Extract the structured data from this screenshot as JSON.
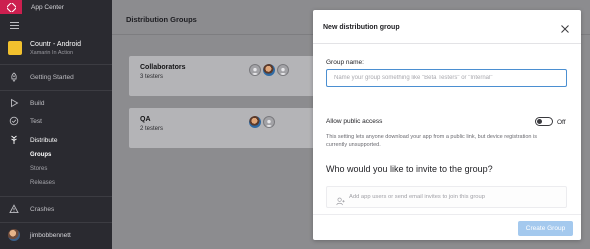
{
  "sidebar": {
    "app_center_label": "App Center",
    "app": {
      "name": "Countr - Android",
      "subtitle": "Xamarin In Action",
      "tile_color": "#f2c12e"
    },
    "items": [
      {
        "label": "Getting Started",
        "icon": "rocket-icon"
      },
      {
        "label": "Build",
        "icon": "play-icon"
      },
      {
        "label": "Test",
        "icon": "check-circle-icon"
      },
      {
        "label": "Distribute",
        "icon": "distribute-icon"
      },
      {
        "label": "Crashes",
        "icon": "warning-icon"
      }
    ],
    "distribute_sub": [
      {
        "label": "Groups"
      },
      {
        "label": "Stores"
      },
      {
        "label": "Releases"
      }
    ],
    "user": {
      "name": "jimbobbennett"
    },
    "brand_color": "#cc1f4f"
  },
  "main": {
    "title": "Distribution Groups",
    "groups": [
      {
        "name": "Collaborators",
        "count": "3 testers"
      },
      {
        "name": "QA",
        "count": "2 testers"
      }
    ]
  },
  "modal": {
    "title": "New distribution group",
    "group_name_label": "Group name:",
    "group_name_placeholder": "Name your group something like \"Beta Testers\" or \"Internal\"",
    "group_name_value": "",
    "public_access_label": "Allow public access",
    "public_access_state": "Off",
    "public_access_desc": "This setting lets anyone download your app from a public link, but device registration is currently unsupported.",
    "invite_heading": "Who would you like to invite to the group?",
    "invite_placeholder": "Add app users or send email invites to join this group",
    "create_button": "Create Group",
    "accent_color": "#4b8fd1"
  }
}
